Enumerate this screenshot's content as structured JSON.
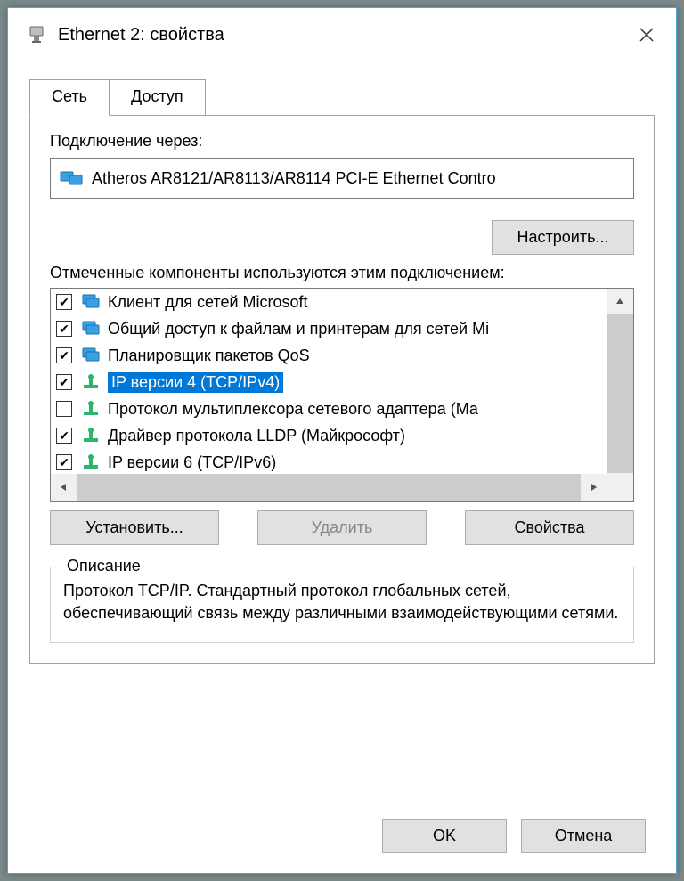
{
  "title": "Ethernet 2: свойства",
  "tabs": {
    "network": "Сеть",
    "access": "Доступ"
  },
  "connect_label": "Подключение через:",
  "adapter": "Atheros AR8121/AR8113/AR8114 PCI-E Ethernet Contro",
  "configure": "Настроить...",
  "components_label": "Отмеченные компоненты используются этим подключением:",
  "items": [
    {
      "checked": true,
      "icon": "monitor",
      "text": "Клиент для сетей Microsoft"
    },
    {
      "checked": true,
      "icon": "monitor",
      "text": "Общий доступ к файлам и принтерам для сетей Mi"
    },
    {
      "checked": true,
      "icon": "monitor",
      "text": "Планировщик пакетов QoS"
    },
    {
      "checked": true,
      "icon": "proto",
      "text": "IP версии 4 (TCP/IPv4)",
      "selected": true
    },
    {
      "checked": false,
      "icon": "proto",
      "text": "Протокол мультиплексора сетевого адаптера (Ма"
    },
    {
      "checked": true,
      "icon": "proto",
      "text": "Драйвер протокола LLDP (Майкрософт)"
    },
    {
      "checked": true,
      "icon": "proto",
      "text": "IP версии 6 (TCP/IPv6)"
    }
  ],
  "buttons": {
    "install": "Установить...",
    "remove": "Удалить",
    "properties": "Свойства"
  },
  "desc_title": "Описание",
  "desc_text": "Протокол TCP/IP. Стандартный протокол глобальных сетей, обеспечивающий связь между различными взаимодействующими сетями.",
  "footer": {
    "ok": "OK",
    "cancel": "Отмена"
  }
}
